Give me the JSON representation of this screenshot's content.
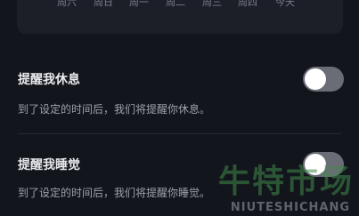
{
  "week_chart": {
    "days": [
      "周六",
      "周日",
      "周一",
      "周二",
      "周三",
      "周四",
      "今天"
    ]
  },
  "settings": {
    "rest_reminder": {
      "title": "提醒我休息",
      "description": "到了设定的时间后，我们将提醒你休息。",
      "enabled": false
    },
    "sleep_reminder": {
      "title": "提醒我睡觉",
      "description": "到了设定的时间后，我们将提醒你睡觉。",
      "enabled": false
    }
  },
  "watermark": {
    "text_cn": "牛特市场",
    "text_en": "NIUTESHICHANG"
  },
  "colors": {
    "background": "#13151c",
    "card": "#1c1f28",
    "toggle_off": "#6a6d76",
    "watermark_green": "#3f8a4a"
  }
}
